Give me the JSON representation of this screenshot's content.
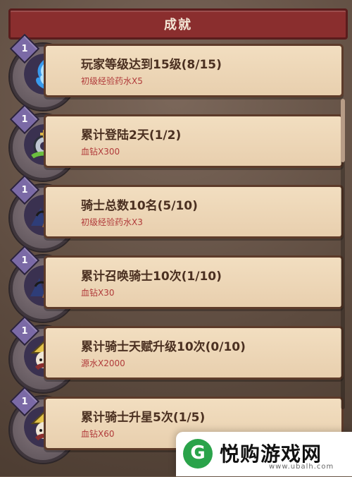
{
  "header": {
    "title": "成就"
  },
  "achievements": [
    {
      "level": "1",
      "title": "玩家等级达到15级(8/15)",
      "reward": "初级经验药水X5",
      "icon": "blue-flame-potion-icon"
    },
    {
      "level": "1",
      "title": "累计登陆2天(1/2)",
      "reward": "血钻X300",
      "icon": "gear-crown-icon"
    },
    {
      "level": "1",
      "title": "骑士总数10名(5/10)",
      "reward": "初级经验药水X3",
      "icon": "knights-group-icon"
    },
    {
      "level": "1",
      "title": "累计召唤骑士10次(1/10)",
      "reward": "血钻X30",
      "icon": "summon-knights-icon"
    },
    {
      "level": "1",
      "title": "累计骑士天赋升级10次(0/10)",
      "reward": "源水X2000",
      "icon": "knight-talent-icon"
    },
    {
      "level": "1",
      "title": "累计骑士升星5次(1/5)",
      "reward": "血钻X60",
      "icon": "knight-star-icon"
    }
  ],
  "watermark": {
    "logo_char": "G",
    "text": "悦购游戏网",
    "url": "www.ubalh.com"
  },
  "colors": {
    "header": "#8a2e2e",
    "card": "#f2dec0",
    "reward_text": "#b03a3a",
    "badge": "#7b6aa6"
  }
}
